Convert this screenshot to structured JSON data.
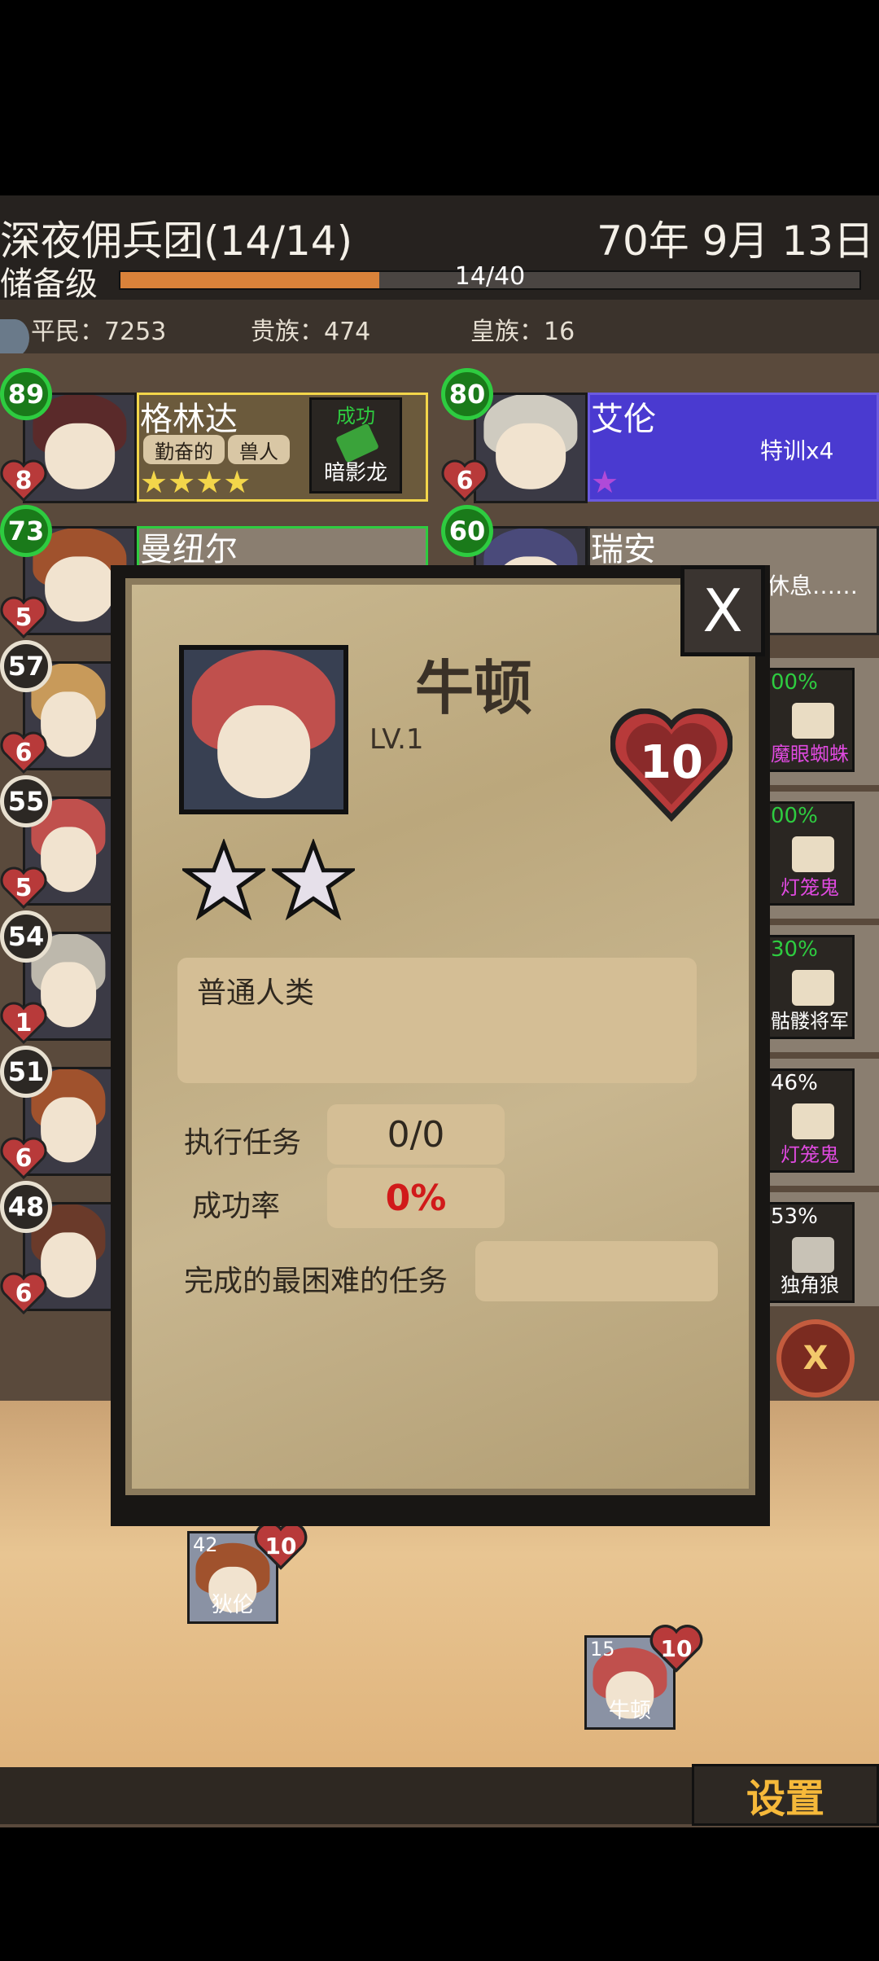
{
  "header": {
    "guild_title": "深夜佣兵团(14/14)",
    "date": "70年 9月 13日",
    "rank": "储备级",
    "progress_text": "14/40",
    "progress_fraction": 0.35
  },
  "stats": {
    "commoners": "平民：7253",
    "nobles": "贵族：474",
    "royals": "皇族：16"
  },
  "roster": [
    {
      "level": "89",
      "hp": "8",
      "name": "格林达",
      "traits": [
        "勤奋的",
        "兽人"
      ],
      "stars": 4,
      "status": "成功",
      "mission": "暗影龙",
      "highlight": "#f3d64a"
    },
    {
      "level": "80",
      "hp": "6",
      "name": "艾伦",
      "note": "特训x4",
      "stars": 1,
      "highlight": "#6a4ad0"
    },
    {
      "level": "73",
      "hp": "5",
      "name": "曼纽尔"
    },
    {
      "level": "60",
      "hp": "",
      "name": "瑞安",
      "note": "休息……"
    },
    {
      "level": "57",
      "hp": "6"
    },
    {
      "level": "55",
      "hp": "5"
    },
    {
      "level": "54",
      "hp": "1"
    },
    {
      "level": "51",
      "hp": "6"
    },
    {
      "level": "48",
      "hp": "6"
    }
  ],
  "right_missions": [
    {
      "pct": "00%",
      "name": "魔眼蜘蛛"
    },
    {
      "pct": "00%",
      "name": "灯笼鬼"
    },
    {
      "pct": "30%",
      "name": "骷髅将军"
    },
    {
      "pct": "46%",
      "name": "灯笼鬼"
    },
    {
      "pct": "53%",
      "name": "独角狼"
    }
  ],
  "modal": {
    "close": "X",
    "hero_name": "牛顿",
    "level": "LV.1",
    "hp": "10",
    "stars": 2,
    "description": "普通人类",
    "missions_label": "执行任务",
    "missions_value": "0/0",
    "success_label": "成功率",
    "success_value": "0%",
    "hardest_label": "完成的最困难的任务",
    "hardest_value": ""
  },
  "tokens": [
    {
      "num": "42",
      "hp": "10",
      "name": "狄伦"
    },
    {
      "num": "15",
      "hp": "10",
      "name": "牛顿"
    }
  ],
  "settings": "设置",
  "colors": {
    "accent_orange": "#d9823a",
    "success_red": "#d11a1a",
    "green_badge": "#2ecc40",
    "heart_red": "#b83a3a"
  }
}
